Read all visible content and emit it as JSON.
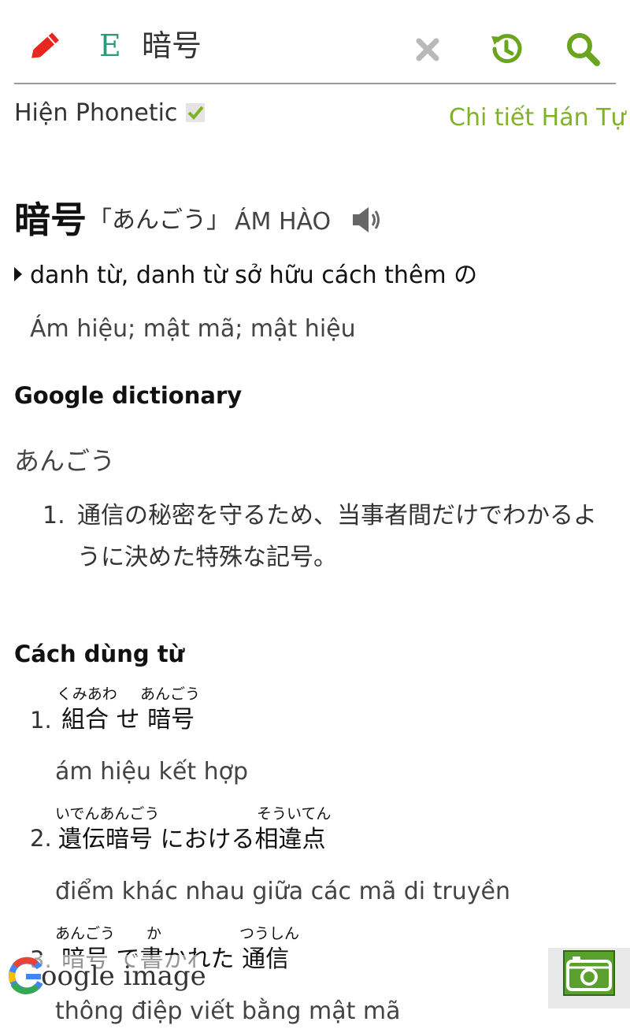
{
  "app": {
    "accent_color": "#7fb225",
    "pencil_color": "#e8251f"
  },
  "search": {
    "mode_label": "E",
    "query": "暗号",
    "icons": [
      "edit-icon",
      "close-icon",
      "history-icon",
      "search-icon"
    ]
  },
  "options": {
    "phonetic_label": "Hiện Phonetic",
    "phonetic_checked": true,
    "han_link": "Chi tiết Hán Tự"
  },
  "entry": {
    "word": "暗号",
    "reading": "「あんごう」",
    "hanviet": "ÁM HÀO",
    "part_of_speech": "danh từ, danh từ sở hữu cách thêm の",
    "meaning": "Ám hiệu; mật mã; mật hiệu"
  },
  "google": {
    "title": "Google dictionary",
    "reading": "あんごう",
    "definitions": [
      {
        "number": "1.",
        "text": "通信の秘密を守るため、当事者間だけでわかるように決めた特殊な記号。"
      }
    ]
  },
  "usage": {
    "title": "Cách dùng từ",
    "examples": [
      {
        "number": "1.",
        "segments": [
          "組合",
          "せ",
          "暗号"
        ],
        "ruby": [
          "くみあわ",
          "あんごう"
        ],
        "translation": "ám hiệu kết hợp"
      },
      {
        "number": "2.",
        "segments": [
          "遺伝暗号",
          "における",
          "相違点"
        ],
        "ruby": [
          "いでんあんごう",
          "そういてん"
        ],
        "translation": "điểm khác nhau giữa các mã di truyền"
      },
      {
        "number": "3.",
        "segments": [
          "暗号",
          "で",
          "書",
          "かれた",
          "通信"
        ],
        "ruby": [
          "あんごう",
          "か",
          "つうしん"
        ],
        "translation": "thông điệp viết bằng mật mã"
      }
    ]
  },
  "overlay": {
    "google_image_label": "oogle image",
    "camera_icon": "camera-icon"
  }
}
